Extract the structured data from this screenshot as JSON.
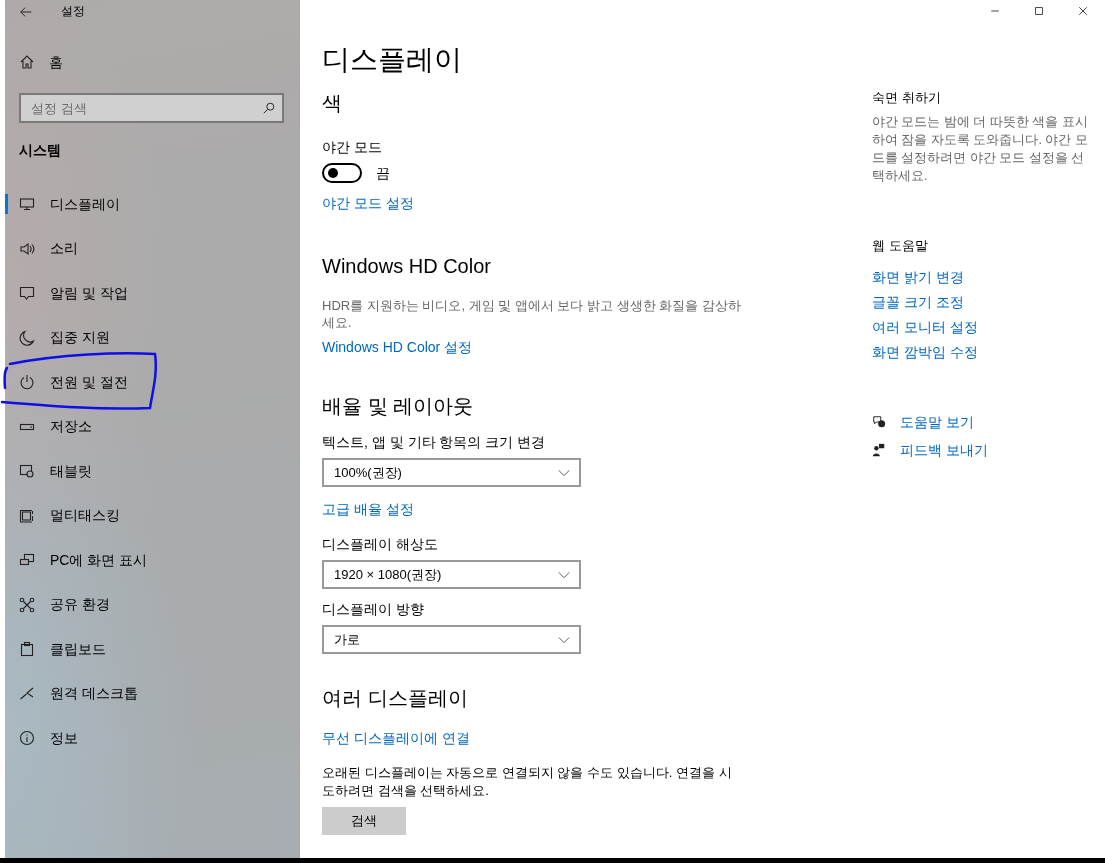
{
  "window": {
    "title": "설정"
  },
  "sidebar": {
    "home": "홈",
    "search": {
      "placeholder": "설정 검색"
    },
    "section": "시스템",
    "items": [
      {
        "label": "디스플레이",
        "selected": true
      },
      {
        "label": "소리",
        "selected": false
      },
      {
        "label": "알림 및 작업",
        "selected": false
      },
      {
        "label": "집중 지원",
        "selected": false
      },
      {
        "label": "전원 및 절전",
        "selected": false
      },
      {
        "label": "저장소",
        "selected": false
      },
      {
        "label": "태블릿",
        "selected": false
      },
      {
        "label": "멀티태스킹",
        "selected": false
      },
      {
        "label": "PC에 화면 표시",
        "selected": false
      },
      {
        "label": "공유 환경",
        "selected": false
      },
      {
        "label": "클립보드",
        "selected": false
      },
      {
        "label": "원격 데스크톱",
        "selected": false
      },
      {
        "label": "정보",
        "selected": false
      }
    ]
  },
  "main": {
    "title": "디스플레이",
    "color": {
      "heading": "색",
      "night_mode": {
        "label": "야간 모드",
        "on": false,
        "state_text": "끔"
      },
      "link": "야간 모드 설정"
    },
    "hd_color": {
      "heading": "Windows HD Color",
      "description": "HDR를 지원하는 비디오, 게임 및 앱에서 보다 밝고 생생한 화질을 감상하세요.",
      "link": "Windows HD Color 설정"
    },
    "scale_layout": {
      "heading": "배율 및 레이아웃",
      "fields": [
        {
          "label": "텍스트, 앱 및 기타 항목의 크기 변경",
          "value": "100%(권장)",
          "link": "고급 배율 설정"
        },
        {
          "label": "디스플레이 해상도",
          "value": "1920 × 1080(권장)"
        },
        {
          "label": "디스플레이 방향",
          "value": "가로"
        }
      ]
    },
    "multiple": {
      "heading": "여러 디스플레이",
      "link": "무선 디스플레이에 연결",
      "description": "오래된 디스플레이는 자동으로 연결되지 않을 수도 있습니다. 연결을 시도하려면 검색을 선택하세요.",
      "button": "검색"
    }
  },
  "aside": {
    "sleep": {
      "heading": "숙면 취하기",
      "text": "야간 모드는 밤에 더 따뜻한 색을 표시하여 잠을 자도록 도와줍니다. 야간 모드를 설정하려면 야간 모드 설정을 선택하세요."
    },
    "web_help": {
      "heading": "웹 도움말",
      "links": [
        "화면 밝기 변경",
        "글꼴 크기 조정",
        "여러 모니터 설정",
        "화면 깜박임 수정"
      ]
    },
    "actions": [
      {
        "kind": "help",
        "label": "도움말 보기"
      },
      {
        "kind": "feedback",
        "label": "피드백 보내기"
      }
    ]
  }
}
